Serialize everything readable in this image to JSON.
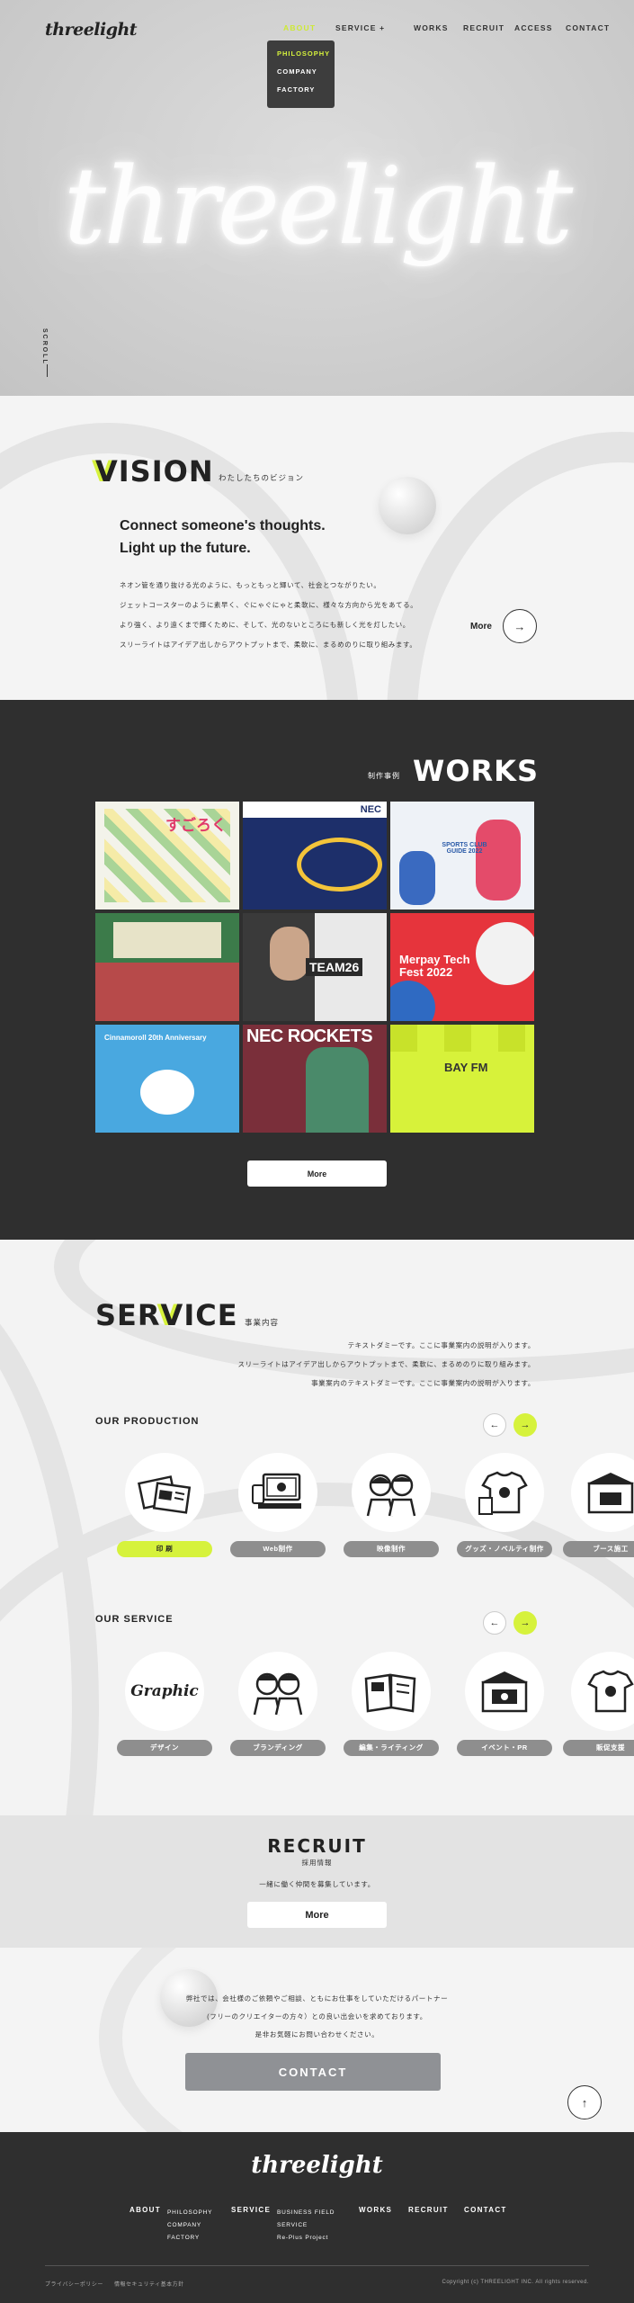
{
  "header": {
    "logo": "threelight",
    "nav": [
      {
        "label": "ABOUT",
        "active": true
      },
      {
        "label": "SERVICE +",
        "active": false
      },
      {
        "label": "WORKS",
        "active": false
      },
      {
        "label": "RECRUIT",
        "active": false
      },
      {
        "label": "ACCESS",
        "active": false
      },
      {
        "label": "CONTACT",
        "active": false
      }
    ],
    "about_dropdown": [
      "PHILOSOPHY",
      "COMPANY",
      "FACTORY"
    ]
  },
  "hero": {
    "neon_text": "threelight",
    "scroll_label": "SCROLL"
  },
  "vision": {
    "title_accent": "V",
    "title_rest": "ISION",
    "subtitle": "わたしたちのビジョン",
    "headline": [
      "Connect someone's thoughts.",
      "Light up the future."
    ],
    "body": [
      "ネオン管を通り抜ける光のように、もっともっと輝いて、社会とつながりたい。",
      "ジェットコースターのように素早く、ぐにゃぐにゃと柔軟に、様々な方向から光をあてる。",
      "より強く、より遠くまで輝くために、そして、光のないところにも新しく光を灯したい。",
      "スリーライトはアイデア出しからアウトプットまで、柔軟に、まるめのりに取り組みます。"
    ],
    "more_label": "More",
    "more_icon": "arrow-right-icon"
  },
  "works": {
    "title": "WORKS",
    "subtitle": "制作事例",
    "tiles": [
      {
        "text": "すごろく",
        "bg": "#f3f3ea",
        "fg": "#e03a6a"
      },
      {
        "text": "NEC",
        "bg": "#1d2f6a",
        "fg": "#ffffff"
      },
      {
        "text": "SPORTS CLUB GUIDE 2022",
        "bg": "#eef2f7",
        "fg": "#2a5aa8"
      },
      {
        "text": "",
        "bg": "#3c7b4a",
        "fg": "#ffffff"
      },
      {
        "text": "TEAM26",
        "bg": "#3a3a3a",
        "fg": "#ffffff"
      },
      {
        "text": "Merpay Tech Fest 2022",
        "bg": "#e6343c",
        "fg": "#ffffff"
      },
      {
        "text": "Cinnamoroll 20th Anniversary",
        "bg": "#49a8e0",
        "fg": "#ffffff"
      },
      {
        "text": "NEC ROCKETS",
        "bg": "#7a2f3a",
        "fg": "#ffffff"
      },
      {
        "text": "BAY FM",
        "bg": "#d7f23a",
        "fg": "#333333"
      }
    ],
    "more_label": "More"
  },
  "service": {
    "title_pre": "SER",
    "title_accent": "V",
    "title_post": "ICE",
    "subtitle": "事業内容",
    "desc": [
      "テキストダミーです。ここに事業案内の説明が入ります。",
      "スリーライトはアイデア出しからアウトプットまで、柔軟に、まるめのりに取り組みます。",
      "事業案内のテキストダミーです。ここに事業案内の説明が入ります。"
    ],
    "production_title": "OUR PRODUCTION",
    "production_items": [
      {
        "label": "印 刷",
        "active": true,
        "icon": "printing-icon"
      },
      {
        "label": "Web制作",
        "active": false,
        "icon": "web-icon"
      },
      {
        "label": "映像制作",
        "active": false,
        "icon": "video-icon"
      },
      {
        "label": "グッズ・ノベルティ制作",
        "active": false,
        "icon": "goods-icon"
      },
      {
        "label": "ブース施工",
        "active": false,
        "icon": "booth-icon"
      }
    ],
    "service_title": "OUR SERVICE",
    "service_items": [
      {
        "label": "デザイン",
        "icon": "graphic-icon",
        "illus_text": "Graphic"
      },
      {
        "label": "ブランディング",
        "icon": "branding-icon",
        "illus_text": ""
      },
      {
        "label": "編集・ライティング",
        "icon": "editing-icon",
        "illus_text": ""
      },
      {
        "label": "イベント・PR",
        "icon": "event-icon",
        "illus_text": ""
      },
      {
        "label": "販促支援",
        "icon": "promotion-icon",
        "illus_text": ""
      }
    ]
  },
  "recruit": {
    "title": "RECRUIT",
    "subtitle": "採用情報",
    "text": "一緒に働く仲間を募集しています。",
    "more_label": "More"
  },
  "contact": {
    "text": [
      "弊社では、会社様のご依頼やご相談、ともにお仕事をしていただけるパートナー",
      "(フリーのクリエイターの方々）との良い出会いを求めております。",
      "是非お気軽にお問い合わせください。"
    ],
    "button_label": "CONTACT",
    "top_icon": "arrow-up-icon"
  },
  "footer": {
    "logo": "threelight",
    "about": {
      "head": "ABOUT",
      "links": [
        "PHILOSOPHY",
        "COMPANY",
        "FACTORY"
      ]
    },
    "service": {
      "head": "SERVICE",
      "links": [
        "BUSINESS FIELD",
        "SERVICE",
        "Re-Plus Project"
      ]
    },
    "works": "WORKS",
    "recruit": "RECRUIT",
    "contact": "CONTACT",
    "privacy": "プライバシーポリシー",
    "security": "情報セキュリティ基本方針",
    "copyright": "Copyright (c) THREELIGHT INC. All rights reserved."
  },
  "colors": {
    "accent": "#d6f23c",
    "dark": "#2f2f2f",
    "grey_pill": "#8e8e8e"
  }
}
